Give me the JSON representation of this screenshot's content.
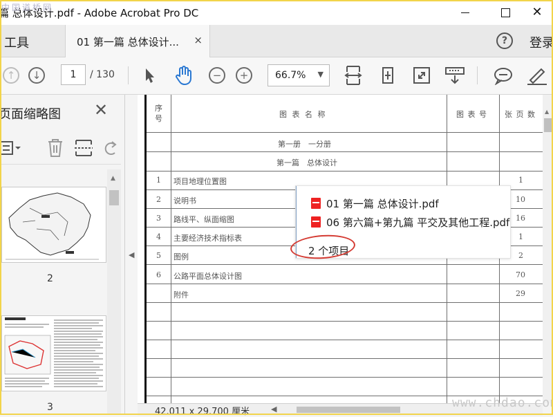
{
  "window": {
    "title": "篇 总体设计.pdf - Adobe Acrobat Pro DC",
    "minimize": "",
    "maximize": "",
    "close": "✕"
  },
  "watermark": {
    "top": "中国道桥网",
    "bottom": "www.chdao.com"
  },
  "tabs": {
    "tools": "工具",
    "document": "01 第一篇 总体设计...",
    "close": "×",
    "signin": "登录",
    "help": "?"
  },
  "toolbar": {
    "page_current": "1",
    "page_total": "/ 130",
    "zoom": "66.7%",
    "zoom_arrow": "▼",
    "icons": [
      "prev-page-icon",
      "next-page-icon",
      "select-arrow-icon",
      "hand-tool-icon",
      "zoom-out-icon",
      "zoom-in-icon",
      "fit-page-icon",
      "rotate-icon",
      "full-screen-icon",
      "scroll-mode-icon",
      "comment-icon",
      "highlight-pen-icon"
    ]
  },
  "left_panel": {
    "title": "页面缩略图",
    "close": "✕",
    "thumbnails": [
      {
        "page": "2"
      },
      {
        "page": "3"
      }
    ]
  },
  "table": {
    "header": {
      "seq": "序号",
      "name": "图 表 名 称",
      "code": "图 表 号",
      "pages": "张 页 数"
    },
    "group1": "第一册　一分册",
    "group2": "第一篇　总体设计",
    "rows": [
      {
        "seq": "1",
        "name": "项目地理位置图",
        "pages": "1"
      },
      {
        "seq": "2",
        "name": "说明书",
        "pages": "10"
      },
      {
        "seq": "3",
        "name": "路线平、纵面缩图",
        "pages": "16"
      },
      {
        "seq": "4",
        "name": "主要经济技术指标表",
        "pages": "1"
      },
      {
        "seq": "5",
        "name": "图例",
        "pages": "2"
      },
      {
        "seq": "6",
        "name": "公路平面总体设计图",
        "pages": "70"
      },
      {
        "seq": "",
        "name": "附件",
        "pages": "29"
      }
    ]
  },
  "drag_popup": {
    "items": [
      "01 第一篇 总体设计.pdf",
      "06 第六篇+第九篇 平交及其他工程.pdf"
    ],
    "count": "2 个项目"
  },
  "status": {
    "dimensions": "42.011 x 29.700 厘米"
  }
}
